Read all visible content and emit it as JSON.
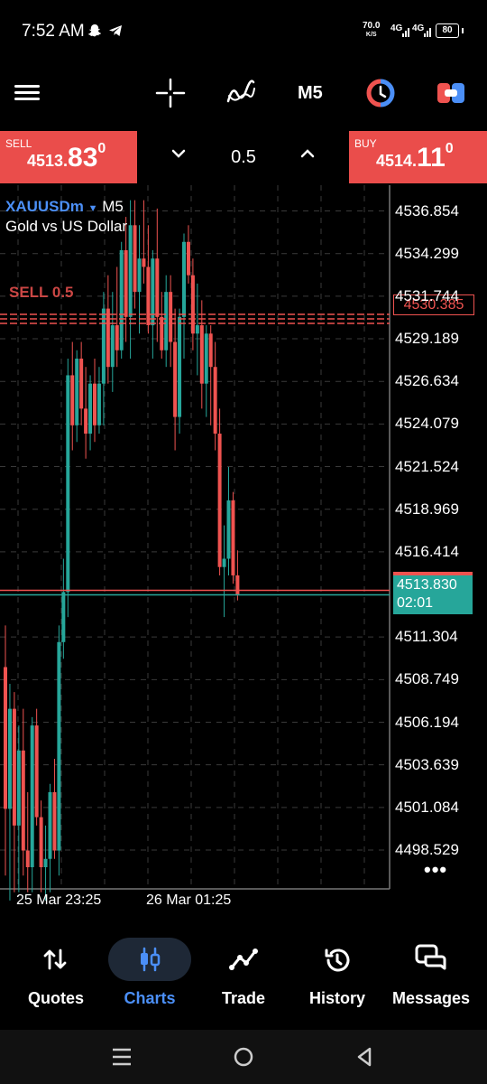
{
  "status_bar": {
    "time": "7:52 AM",
    "net_speed_value": "70.0",
    "net_speed_unit": "K/S",
    "signal1": "4G",
    "signal2": "4G",
    "battery": "80"
  },
  "toolbar": {
    "timeframe": "M5",
    "icons": [
      "menu-icon",
      "crosshair-icon",
      "indicators-icon",
      "timeframe",
      "one-click-trading-icon",
      "trade-panel-icon"
    ]
  },
  "trade_panel": {
    "sell_label": "SELL",
    "sell_price_small": "4513.",
    "sell_price_big": "83",
    "sell_price_sup": "0",
    "lot": "0.5",
    "buy_label": "BUY",
    "buy_price_small": "4514.",
    "buy_price_big": "11",
    "buy_price_sup": "0"
  },
  "chart": {
    "symbol": "XAUUSDm",
    "timeframe": "M5",
    "description": "Gold vs US Dollar",
    "order_line_text": "SELL 0.5",
    "order_line_price": "4530.385",
    "price_labels": [
      "4536.854",
      "4534.299",
      "4531.744",
      "4529.189",
      "4526.634",
      "4524.079",
      "4521.524",
      "4518.969",
      "4516.414",
      "4511.304",
      "4508.749",
      "4506.194",
      "4503.639",
      "4501.084",
      "4498.529"
    ],
    "current_price": "4513.830",
    "bar_countdown": "02:01",
    "time_labels": [
      "25 Mar 23:25",
      "26 Mar 01:25"
    ],
    "colors": {
      "bull": "#26a69a",
      "bear": "#ef5350",
      "grid": "#3a3a3a",
      "order_line": "#ef5350",
      "bid_line": "#26a69a",
      "ask_line": "#ef5350"
    }
  },
  "chart_data": {
    "type": "candlestick",
    "symbol": "XAUUSDm",
    "timeframe": "M5",
    "ylim": [
      4496.2,
      4538.4
    ],
    "candles": [
      {
        "o": 4509.5,
        "h": 4512.0,
        "l": 4497.0,
        "c": 4501.0
      },
      {
        "o": 4501.0,
        "h": 4508.5,
        "l": 4495.5,
        "c": 4507.0
      },
      {
        "o": 4507.0,
        "h": 4508.0,
        "l": 4496.0,
        "c": 4500.0
      },
      {
        "o": 4500.0,
        "h": 4506.0,
        "l": 4496.0,
        "c": 4504.5
      },
      {
        "o": 4504.5,
        "h": 4507.0,
        "l": 4497.0,
        "c": 4498.5
      },
      {
        "o": 4498.5,
        "h": 4502.0,
        "l": 4496.0,
        "c": 4497.5
      },
      {
        "o": 4497.5,
        "h": 4506.5,
        "l": 4496.0,
        "c": 4506.0
      },
      {
        "o": 4506.0,
        "h": 4507.0,
        "l": 4500.0,
        "c": 4500.5
      },
      {
        "o": 4500.5,
        "h": 4501.5,
        "l": 4496.0,
        "c": 4497.5
      },
      {
        "o": 4497.5,
        "h": 4500.0,
        "l": 4495.5,
        "c": 4498.0
      },
      {
        "o": 4498.0,
        "h": 4502.5,
        "l": 4496.0,
        "c": 4502.0
      },
      {
        "o": 4502.0,
        "h": 4504.0,
        "l": 4498.0,
        "c": 4498.5
      },
      {
        "o": 4498.5,
        "h": 4512.0,
        "l": 4497.0,
        "c": 4511.0
      },
      {
        "o": 4511.0,
        "h": 4516.0,
        "l": 4510.0,
        "c": 4514.0
      },
      {
        "o": 4514.0,
        "h": 4528.0,
        "l": 4512.5,
        "c": 4527.0
      },
      {
        "o": 4527.0,
        "h": 4529.0,
        "l": 4522.5,
        "c": 4524.0
      },
      {
        "o": 4524.0,
        "h": 4528.5,
        "l": 4523.0,
        "c": 4528.0
      },
      {
        "o": 4528.0,
        "h": 4529.0,
        "l": 4524.0,
        "c": 4525.0
      },
      {
        "o": 4525.0,
        "h": 4527.5,
        "l": 4522.0,
        "c": 4523.5
      },
      {
        "o": 4523.5,
        "h": 4527.0,
        "l": 4522.5,
        "c": 4526.5
      },
      {
        "o": 4526.5,
        "h": 4528.0,
        "l": 4523.0,
        "c": 4524.0
      },
      {
        "o": 4524.0,
        "h": 4527.5,
        "l": 4523.5,
        "c": 4526.5
      },
      {
        "o": 4526.5,
        "h": 4532.0,
        "l": 4524.0,
        "c": 4531.0
      },
      {
        "o": 4531.0,
        "h": 4533.0,
        "l": 4526.5,
        "c": 4527.5
      },
      {
        "o": 4527.5,
        "h": 4532.0,
        "l": 4526.0,
        "c": 4530.0
      },
      {
        "o": 4530.0,
        "h": 4533.5,
        "l": 4527.5,
        "c": 4528.5
      },
      {
        "o": 4528.5,
        "h": 4535.0,
        "l": 4528.0,
        "c": 4534.5
      },
      {
        "o": 4534.5,
        "h": 4536.5,
        "l": 4529.0,
        "c": 4530.5
      },
      {
        "o": 4530.5,
        "h": 4537.5,
        "l": 4528.0,
        "c": 4536.0
      },
      {
        "o": 4536.0,
        "h": 4537.5,
        "l": 4531.0,
        "c": 4532.0
      },
      {
        "o": 4532.0,
        "h": 4536.0,
        "l": 4529.5,
        "c": 4534.0
      },
      {
        "o": 4534.0,
        "h": 4537.5,
        "l": 4532.5,
        "c": 4533.5
      },
      {
        "o": 4533.5,
        "h": 4536.0,
        "l": 4529.5,
        "c": 4530.0
      },
      {
        "o": 4530.0,
        "h": 4534.5,
        "l": 4528.0,
        "c": 4534.0
      },
      {
        "o": 4534.0,
        "h": 4537.0,
        "l": 4529.0,
        "c": 4530.5
      },
      {
        "o": 4530.5,
        "h": 4532.0,
        "l": 4528.0,
        "c": 4528.5
      },
      {
        "o": 4528.5,
        "h": 4533.0,
        "l": 4527.5,
        "c": 4532.0
      },
      {
        "o": 4532.0,
        "h": 4533.0,
        "l": 4527.5,
        "c": 4529.0
      },
      {
        "o": 4529.0,
        "h": 4531.0,
        "l": 4522.5,
        "c": 4524.5
      },
      {
        "o": 4524.5,
        "h": 4531.0,
        "l": 4523.5,
        "c": 4530.5
      },
      {
        "o": 4530.5,
        "h": 4535.5,
        "l": 4528.0,
        "c": 4535.0
      },
      {
        "o": 4535.0,
        "h": 4536.0,
        "l": 4532.5,
        "c": 4533.0
      },
      {
        "o": 4533.0,
        "h": 4534.0,
        "l": 4528.5,
        "c": 4529.5
      },
      {
        "o": 4529.5,
        "h": 4532.5,
        "l": 4527.0,
        "c": 4530.0
      },
      {
        "o": 4530.0,
        "h": 4531.5,
        "l": 4525.0,
        "c": 4526.5
      },
      {
        "o": 4526.5,
        "h": 4530.0,
        "l": 4524.5,
        "c": 4529.5
      },
      {
        "o": 4529.5,
        "h": 4530.0,
        "l": 4524.0,
        "c": 4527.5
      },
      {
        "o": 4527.5,
        "h": 4529.0,
        "l": 4522.5,
        "c": 4523.5
      },
      {
        "o": 4523.5,
        "h": 4525.0,
        "l": 4515.0,
        "c": 4515.5
      },
      {
        "o": 4515.5,
        "h": 4518.0,
        "l": 4512.5,
        "c": 4516.0
      },
      {
        "o": 4516.0,
        "h": 4521.5,
        "l": 4515.0,
        "c": 4519.5
      },
      {
        "o": 4519.5,
        "h": 4520.0,
        "l": 4514.5,
        "c": 4515.0
      },
      {
        "o": 4515.0,
        "h": 4516.5,
        "l": 4513.5,
        "c": 4513.8
      }
    ]
  },
  "bottom_nav": [
    {
      "label": "Quotes",
      "icon": "quotes-icon",
      "active": false
    },
    {
      "label": "Charts",
      "icon": "charts-icon",
      "active": true
    },
    {
      "label": "Trade",
      "icon": "trade-icon",
      "active": false
    },
    {
      "label": "History",
      "icon": "history-icon",
      "active": false
    },
    {
      "label": "Messages",
      "icon": "messages-icon",
      "active": false
    }
  ]
}
